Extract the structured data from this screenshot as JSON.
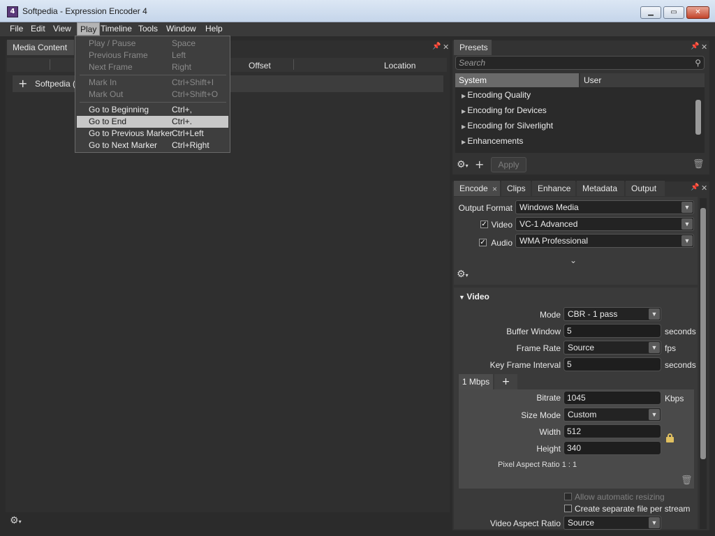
{
  "window": {
    "title": "Softpedia - Expression Encoder 4",
    "icon_text": "4",
    "minimize": "▁",
    "maximize": "▭",
    "close": "✕"
  },
  "menubar": [
    "File",
    "Edit",
    "View",
    "Play",
    "Timeline",
    "Tools",
    "Window",
    "Help"
  ],
  "play_menu": {
    "items": [
      {
        "label": "Play / Pause",
        "shortcut": "Space",
        "enabled": false
      },
      {
        "label": "Previous Frame",
        "shortcut": "Left",
        "enabled": false
      },
      {
        "label": "Next Frame",
        "shortcut": "Right",
        "enabled": false
      },
      {
        "label": "Mark In",
        "shortcut": "Ctrl+Shift+I",
        "enabled": false
      },
      {
        "label": "Mark Out",
        "shortcut": "Ctrl+Shift+O",
        "enabled": false
      },
      {
        "label": "Go to Beginning",
        "shortcut": "Ctrl+,",
        "enabled": true
      },
      {
        "label": "Go to End",
        "shortcut": "Ctrl+.",
        "enabled": true,
        "highlighted": true
      },
      {
        "label": "Go to Previous Marker",
        "shortcut": "Ctrl+Left",
        "enabled": true
      },
      {
        "label": "Go to Next Marker",
        "shortcut": "Ctrl+Right",
        "enabled": true
      }
    ]
  },
  "media": {
    "tab": "Media Content",
    "columns": [
      "Offset",
      "Location"
    ],
    "row_label": "Softpedia (",
    "add": "+",
    "gear": "⚙"
  },
  "presets": {
    "tab": "Presets",
    "search_placeholder": "Search",
    "tabs": [
      "System",
      "User"
    ],
    "items": [
      "Encoding Quality",
      "Encoding for Devices",
      "Encoding for Silverlight",
      "Enhancements"
    ],
    "apply": "Apply",
    "gear": "⚙",
    "add": "+"
  },
  "encode": {
    "tabs": [
      "Encode",
      "Clips",
      "Enhance",
      "Metadata",
      "Output"
    ],
    "output_format_label": "Output Format",
    "output_format": "Windows Media",
    "video_label": "Video",
    "video_codec": "VC-1 Advanced",
    "audio_label": "Audio",
    "audio_codec": "WMA Professional",
    "video_checked": true,
    "audio_checked": true,
    "video_section": "Video",
    "mode_label": "Mode",
    "mode": "CBR - 1 pass",
    "buffer_label": "Buffer Window",
    "buffer": "5",
    "buffer_unit": "seconds",
    "framerate_label": "Frame Rate",
    "framerate": "Source",
    "framerate_unit": "fps",
    "keyframe_label": "Key Frame Interval",
    "keyframe": "5",
    "keyframe_unit": "seconds",
    "stream_tab": "1 Mbps",
    "stream_add": "+",
    "bitrate_label": "Bitrate",
    "bitrate": "1045",
    "bitrate_unit": "Kbps",
    "sizemode_label": "Size Mode",
    "sizemode": "Custom",
    "width_label": "Width",
    "width": "512",
    "height_label": "Height",
    "height": "340",
    "par": "Pixel Aspect Ratio 1 : 1",
    "allow_resize": "Allow automatic resizing",
    "separate_file": "Create separate file per stream",
    "var_label": "Video Aspect Ratio",
    "var": "Source"
  }
}
